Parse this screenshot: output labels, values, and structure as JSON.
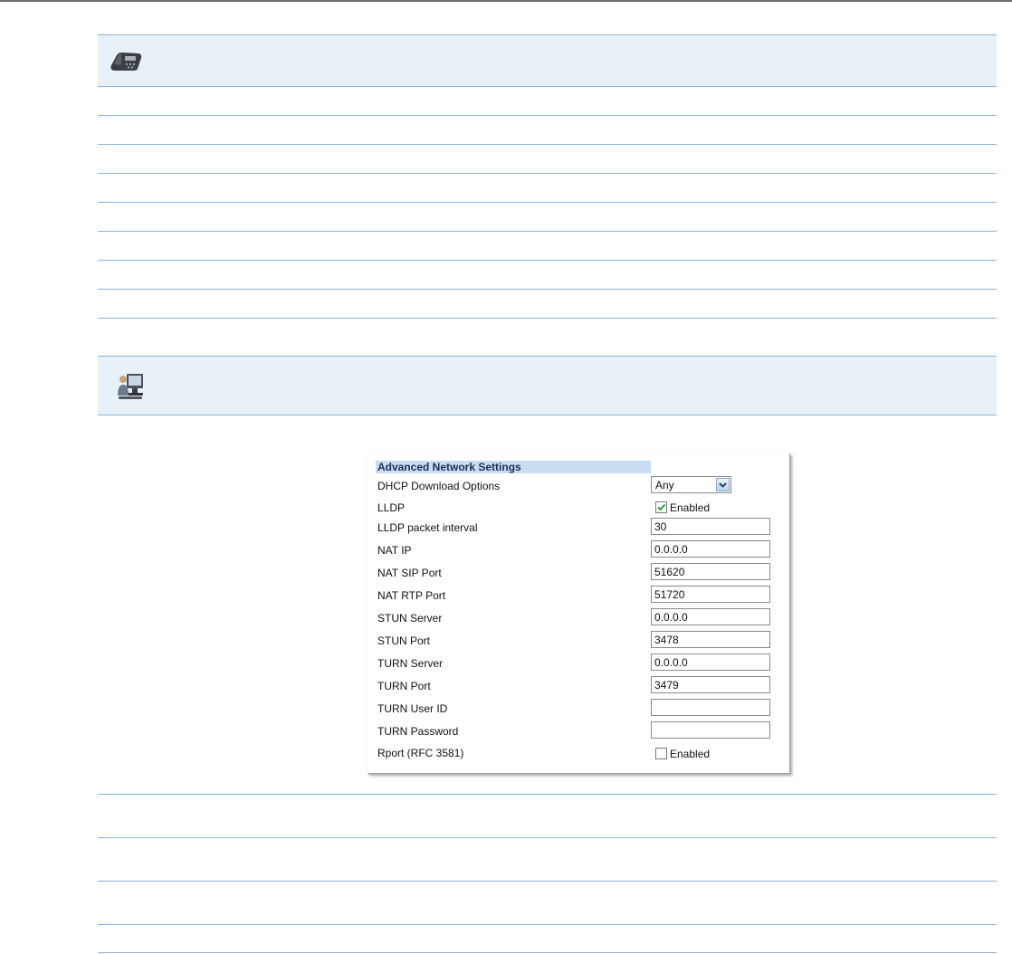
{
  "icons": {
    "section1": "desk-phone-icon",
    "section2": "computer-user-icon"
  },
  "panel": {
    "title": "Advanced Network Settings",
    "dhcp_label": "DHCP Download Options",
    "dhcp_value": "Any",
    "lldp_label": "LLDP",
    "lldp_checked": true,
    "lldp_check_label": "Enabled",
    "lldp_interval_label": "LLDP packet interval",
    "lldp_interval_value": "30",
    "nat_ip_label": "NAT IP",
    "nat_ip_value": "0.0.0.0",
    "nat_sip_port_label": "NAT SIP Port",
    "nat_sip_port_value": "51620",
    "nat_rtp_port_label": "NAT RTP Port",
    "nat_rtp_port_value": "51720",
    "stun_server_label": "STUN Server",
    "stun_server_value": "0.0.0.0",
    "stun_port_label": "STUN Port",
    "stun_port_value": "3478",
    "turn_server_label": "TURN Server",
    "turn_server_value": "0.0.0.0",
    "turn_port_label": "TURN Port",
    "turn_port_value": "3479",
    "turn_user_label": "TURN User ID",
    "turn_user_value": "",
    "turn_password_label": "TURN Password",
    "turn_password_value": "",
    "rport_label": "Rport (RFC 3581)",
    "rport_checked": false,
    "rport_check_label": "Enabled"
  },
  "colors": {
    "rule": "#8ab4dc",
    "band": "#e8f0f8",
    "panel_title_bg": "#c8dcf2"
  }
}
